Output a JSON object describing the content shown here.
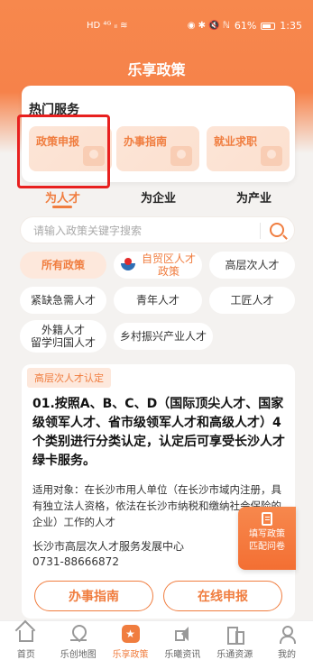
{
  "status_bar": {
    "left_glyphs": "HD ⁴ᴳ ᵢₗ ≋",
    "right_glyphs": "◉ ✱ 🔇 ℕ",
    "battery": "61%",
    "time": "1:35"
  },
  "page": {
    "title": "乐享政策"
  },
  "hot_services": {
    "title": "热门服务",
    "items": [
      {
        "label": "政策申报"
      },
      {
        "label": "办事指南"
      },
      {
        "label": "就业求职"
      }
    ]
  },
  "audience_tabs": [
    {
      "label": "为人才",
      "active": true
    },
    {
      "label": "为企业",
      "active": false
    },
    {
      "label": "为产业",
      "active": false
    }
  ],
  "search": {
    "placeholder": "请输入政策关键字搜索"
  },
  "categories": [
    {
      "label": "所有政策",
      "active": true
    },
    {
      "label_line1": "自贸区人才",
      "label_line2": "政策"
    },
    {
      "label": "高层次人才"
    },
    {
      "label": "紧缺急需人才"
    },
    {
      "label": "青年人才"
    },
    {
      "label": "工匠人才"
    },
    {
      "label_line1": "外籍人才",
      "label_line2": "留学归国人才"
    },
    {
      "label": "乡村振兴产业人才"
    }
  ],
  "policy": {
    "tag": "高层次人才认定",
    "heading": "01.按照A、B、C、D（国际顶尖人才、国家级领军人才、省市级领军人才和高级人才）4个类别进行分类认定，认定后可享受长沙人才绿卡服务。",
    "scope": "适用对象：在长沙市用人单位（在长沙市域内注册，具有独立法人资格，依法在长沙市纳税和缴纳社会保险的企业）工作的人才",
    "org": "长沙市高层次人才服务发展中心",
    "phone": "0731-88666872",
    "btn_guide": "办事指南",
    "btn_apply": "在线申报"
  },
  "float_survey": {
    "line1": "填写政策",
    "line2": "匹配问卷"
  },
  "bottom_nav": [
    {
      "label": "首页"
    },
    {
      "label": "乐创地图"
    },
    {
      "label": "乐享政策",
      "active": true
    },
    {
      "label": "乐曦资讯"
    },
    {
      "label": "乐通资源"
    },
    {
      "label": "我的"
    }
  ],
  "colors": {
    "accent": "#f07d3f",
    "header": "#f6824a",
    "highlight": "#e8201f"
  }
}
